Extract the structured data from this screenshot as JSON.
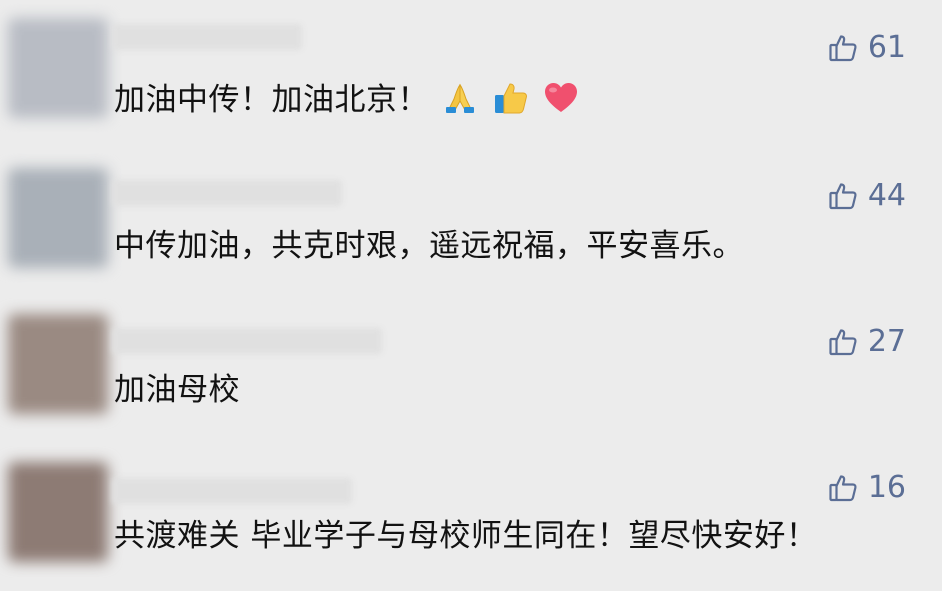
{
  "comments": [
    {
      "text": "加油中传！加油北京！",
      "likes": "61",
      "emoji": [
        "folded-hands-emoji",
        "thumbs-up-emoji",
        "red-heart-emoji"
      ],
      "avatar_color": "#b8bcc4"
    },
    {
      "text": "中传加油，共克时艰，遥远祝福，平安喜乐。",
      "likes": "44",
      "emoji": [],
      "avatar_color": "#a9b0b8"
    },
    {
      "text": "加油母校",
      "likes": "27",
      "emoji": [],
      "avatar_color": "#9a8a82"
    },
    {
      "text": "共渡难关 毕业学子与母校师生同在！望尽快安好！",
      "likes": "16",
      "emoji": [],
      "avatar_color": "#8d7b74"
    }
  ],
  "colors": {
    "background": "#ececec",
    "like_accent": "#5b6e95",
    "text": "#121212"
  }
}
